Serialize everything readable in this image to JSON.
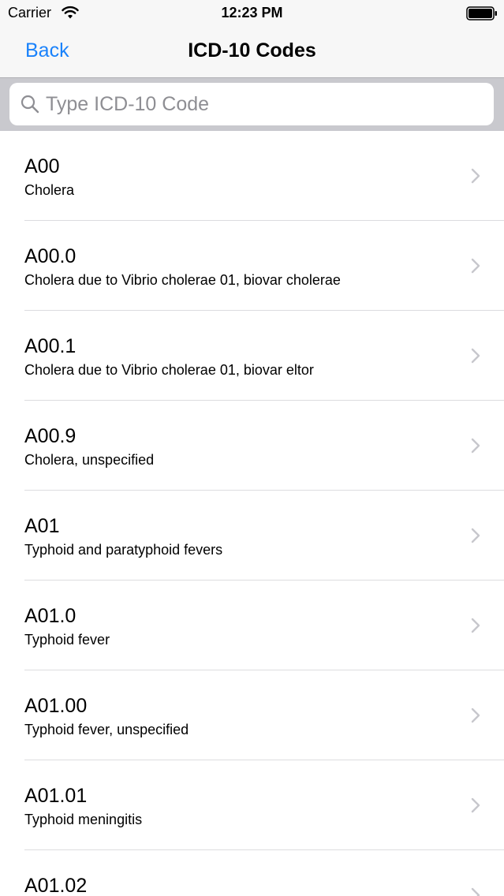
{
  "status_bar": {
    "carrier": "Carrier",
    "time": "12:23 PM"
  },
  "nav": {
    "back_label": "Back",
    "title": "ICD-10 Codes"
  },
  "search": {
    "placeholder": "Type ICD-10 Code"
  },
  "colors": {
    "accent": "#1a82fb",
    "placeholder": "#8e8e93",
    "search_bar_bg": "#c9c9ce"
  },
  "icons": {
    "wifi": "wifi-icon",
    "battery": "battery-icon",
    "search": "search-icon",
    "row_disclosure": "chevron-right-icon"
  },
  "items": [
    {
      "code": "A00",
      "description": "Cholera"
    },
    {
      "code": "A00.0",
      "description": "Cholera due to Vibrio cholerae 01, biovar cholerae"
    },
    {
      "code": "A00.1",
      "description": "Cholera due to Vibrio cholerae 01, biovar eltor"
    },
    {
      "code": "A00.9",
      "description": "Cholera, unspecified"
    },
    {
      "code": "A01",
      "description": "Typhoid and paratyphoid fevers"
    },
    {
      "code": "A01.0",
      "description": "Typhoid fever"
    },
    {
      "code": "A01.00",
      "description": "Typhoid fever, unspecified"
    },
    {
      "code": "A01.01",
      "description": "Typhoid meningitis"
    },
    {
      "code": "A01.02",
      "description": ""
    }
  ]
}
